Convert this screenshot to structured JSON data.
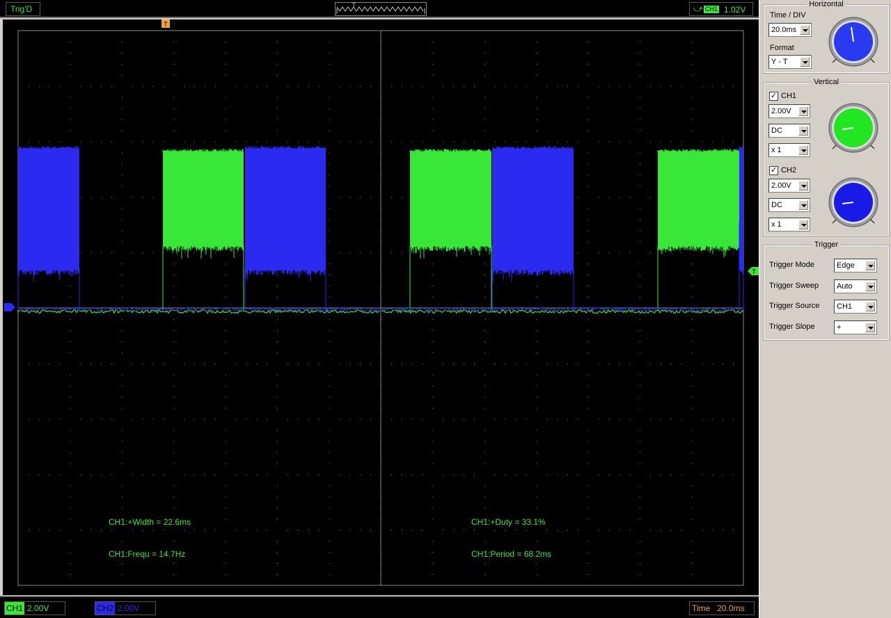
{
  "topbar": {
    "trig_status": "Trig'D",
    "preview_marker": "T",
    "trigger_edge_icon": "rising-edge-icon",
    "trigger_channel": "CH1",
    "trigger_level": "1.02V"
  },
  "display": {
    "trigger_pos_marker": "T",
    "ch_marker": "T",
    "measurements": [
      {
        "text": "CH1:+Width = 22.6ms"
      },
      {
        "text": "CH1:+Duty = 33.1%"
      },
      {
        "text": "CH1:Frequ = 14.7Hz"
      },
      {
        "text": "CH1:Period = 68.2ms"
      }
    ],
    "colors": {
      "ch1": "#39e739",
      "ch2": "#2a2af0",
      "grid": "#8a8a8a",
      "trigger": "#f0a040"
    }
  },
  "bottombar": {
    "ch1_tag": "CH1",
    "ch1_scale": "2.00V",
    "ch2_tag": "CH2",
    "ch2_scale": "2.00V",
    "time_label": "Time",
    "time_value": "20.0ms"
  },
  "panel": {
    "horizontal": {
      "title": "Horizontal",
      "time_div_label": "Time / DIV",
      "time_div_value": "20.0ms",
      "format_label": "Format",
      "format_value": "Y - T"
    },
    "vertical": {
      "title": "Vertical",
      "ch1_label": "CH1",
      "ch1_volts": "2.00V",
      "ch1_coupling": "DC",
      "ch1_probe": "x 1",
      "ch2_label": "CH2",
      "ch2_volts": "2.00V",
      "ch2_coupling": "DC",
      "ch2_probe": "x 1"
    },
    "trigger": {
      "title": "Trigger",
      "mode_label": "Trigger Mode",
      "mode_value": "Edge",
      "sweep_label": "Trigger Sweep",
      "sweep_value": "Auto",
      "source_label": "Trigger Source",
      "source_value": "CH1",
      "slope_label": "Trigger Slope",
      "slope_value": "+"
    }
  }
}
